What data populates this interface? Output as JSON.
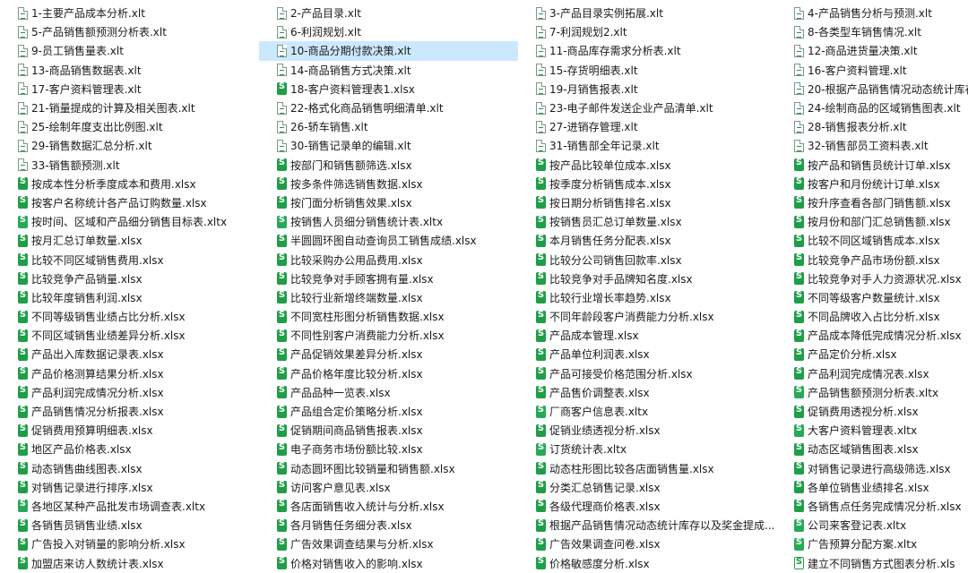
{
  "files": [
    {
      "name": "1-主要产品成本分析.xlt",
      "type": "xlt"
    },
    {
      "name": "5-产品销售额预测分析表.xlt",
      "type": "xlt"
    },
    {
      "name": "9-员工销售量表.xlt",
      "type": "xlt"
    },
    {
      "name": "13-商品销售数据表.xlt",
      "type": "xlt"
    },
    {
      "name": "17-客户资料管理表.xlt",
      "type": "xlt"
    },
    {
      "name": "21-销量提成的计算及相关图表.xlt",
      "type": "xlt"
    },
    {
      "name": "25-绘制年度支出比例图.xlt",
      "type": "xlt"
    },
    {
      "name": "29-销售数据汇总分析.xlt",
      "type": "xlt"
    },
    {
      "name": "33-销售额预测.xlt",
      "type": "xlt"
    },
    {
      "name": "按成本性分析季度成本和费用.xlsx",
      "type": "xlsx"
    },
    {
      "name": "按客户名称统计各产品订购数量.xlsx",
      "type": "xlsx"
    },
    {
      "name": "按时间、区域和产品细分销售目标表.xltx",
      "type": "xltx"
    },
    {
      "name": "按月汇总订单数量.xlsx",
      "type": "xlsx"
    },
    {
      "name": "比较不同区域销售费用.xlsx",
      "type": "xlsx"
    },
    {
      "name": "比较竞争产品销量.xlsx",
      "type": "xlsx"
    },
    {
      "name": "比较年度销售利润.xlsx",
      "type": "xlsx"
    },
    {
      "name": "不同等级销售业绩占比分析.xlsx",
      "type": "xlsx"
    },
    {
      "name": "不同区域销售业绩差异分析.xlsx",
      "type": "xlsx"
    },
    {
      "name": "产品出入库数据记录表.xlsx",
      "type": "xlsx"
    },
    {
      "name": "产品价格测算结果分析.xlsx",
      "type": "xlsx"
    },
    {
      "name": "产品利润完成情况分析.xlsx",
      "type": "xlsx"
    },
    {
      "name": "产品销售情况分析报表.xlsx",
      "type": "xlsx"
    },
    {
      "name": "促销费用预算明细表.xlsx",
      "type": "xlsx"
    },
    {
      "name": "地区产品价格表.xlsx",
      "type": "xlsx"
    },
    {
      "name": "动态销售曲线图表.xlsx",
      "type": "xlsx"
    },
    {
      "name": "对销售记录进行排序.xlsx",
      "type": "xlsx"
    },
    {
      "name": "各地区某种产品批发市场调查表.xltx",
      "type": "xltx"
    },
    {
      "name": "各销售员销售业绩.xlsx",
      "type": "xlsx"
    },
    {
      "name": "广告投入对销量的影响分析.xlsx",
      "type": "xlsx"
    },
    {
      "name": "加盟店来访人数统计表.xlsx",
      "type": "xlsx"
    },
    {
      "name": "2-产品目录.xlt",
      "type": "xlt"
    },
    {
      "name": "6-利润规划.xlt",
      "type": "xlt"
    },
    {
      "name": "10-商品分期付款决策.xlt",
      "type": "xlt",
      "selected": true
    },
    {
      "name": "14-商品销售方式决策.xlt",
      "type": "xlt"
    },
    {
      "name": "18-客户资料管理表1.xlsx",
      "type": "xlsx"
    },
    {
      "name": "22-格式化商品销售明细清单.xlt",
      "type": "xlt"
    },
    {
      "name": "26-轿车销售.xlt",
      "type": "xlt"
    },
    {
      "name": "30-销售记录单的编辑.xlt",
      "type": "xlt"
    },
    {
      "name": "按部门和销售额筛选.xlsx",
      "type": "xlsx"
    },
    {
      "name": "按多条件筛选销售数据.xlsx",
      "type": "xlsx"
    },
    {
      "name": "按门面分析销售效果.xlsx",
      "type": "xlsx"
    },
    {
      "name": "按销售人员细分销售统计表.xltx",
      "type": "xltx"
    },
    {
      "name": "半圆圆环图自动查询员工销售成绩.xlsx",
      "type": "xlsx"
    },
    {
      "name": "比较采购办公用品费用.xlsx",
      "type": "xlsx"
    },
    {
      "name": "比较竞争对手顾客拥有量.xlsx",
      "type": "xlsx"
    },
    {
      "name": "比较行业新增终端数量.xlsx",
      "type": "xlsx"
    },
    {
      "name": "不同宽柱形图分析销售数据.xlsx",
      "type": "xlsx"
    },
    {
      "name": "不同性别客户消费能力分析.xlsx",
      "type": "xlsx"
    },
    {
      "name": "产品促销效果差异分析.xlsx",
      "type": "xlsx"
    },
    {
      "name": "产品价格年度比较分析.xlsx",
      "type": "xlsx"
    },
    {
      "name": "产品品种一览表.xlsx",
      "type": "xlsx"
    },
    {
      "name": "产品组合定价策略分析.xlsx",
      "type": "xlsx"
    },
    {
      "name": "促销期间商品销售报表.xlsx",
      "type": "xlsx"
    },
    {
      "name": "电子商务市场份额比较.xlsx",
      "type": "xlsx"
    },
    {
      "name": "动态圆环图比较销量和销售额.xlsx",
      "type": "xlsx"
    },
    {
      "name": "访问客户意见表.xlsx",
      "type": "xlsx"
    },
    {
      "name": "各店面销售收入统计与分析.xlsx",
      "type": "xlsx"
    },
    {
      "name": "各月销售任务细分表.xlsx",
      "type": "xlsx"
    },
    {
      "name": "广告效果调查结果与分析.xlsx",
      "type": "xlsx"
    },
    {
      "name": "价格对销售收入的影响.xlsx",
      "type": "xlsx"
    },
    {
      "name": "3-产品目录实例拓展.xlt",
      "type": "xlt"
    },
    {
      "name": "7-利润规划2.xlt",
      "type": "xlt"
    },
    {
      "name": "11-商品库存需求分析表.xlt",
      "type": "xlt"
    },
    {
      "name": "15-存货明细表.xlt",
      "type": "xlt"
    },
    {
      "name": "19-月销售报表.xlt",
      "type": "xlt"
    },
    {
      "name": "23-电子邮件发送企业产品清单.xlt",
      "type": "xlt"
    },
    {
      "name": "27-进销存管理.xlt",
      "type": "xlt"
    },
    {
      "name": "31-销售部全年记录.xlt",
      "type": "xlt"
    },
    {
      "name": "按产品比较单位成本.xlsx",
      "type": "xlsx"
    },
    {
      "name": "按季度分析销售成本.xlsx",
      "type": "xlsx"
    },
    {
      "name": "按日期分析销售排名.xlsx",
      "type": "xlsx"
    },
    {
      "name": "按销售员汇总订单数量.xlsx",
      "type": "xlsx"
    },
    {
      "name": "本月销售任务分配表.xlsx",
      "type": "xlsx"
    },
    {
      "name": "比较分公司销售回款率.xlsx",
      "type": "xlsx"
    },
    {
      "name": "比较竞争对手品牌知名度.xlsx",
      "type": "xlsx"
    },
    {
      "name": "比较行业增长率趋势.xlsx",
      "type": "xlsx"
    },
    {
      "name": "不同年龄段客户消费能力分析.xlsx",
      "type": "xlsx"
    },
    {
      "name": "产品成本管理.xlsx",
      "type": "xlsx"
    },
    {
      "name": "产品单位利润表.xlsx",
      "type": "xlsx"
    },
    {
      "name": "产品可接受价格范围分析.xlsx",
      "type": "xlsx"
    },
    {
      "name": "产品售价调整表.xlsx",
      "type": "xlsx"
    },
    {
      "name": "厂商客户信息表.xltx",
      "type": "xltx"
    },
    {
      "name": "促销业绩透视分析.xlsx",
      "type": "xlsx"
    },
    {
      "name": "订货统计表.xltx",
      "type": "xltx"
    },
    {
      "name": "动态柱形图比较各店面销售量.xlsx",
      "type": "xlsx"
    },
    {
      "name": "分类汇总销售记录.xlsx",
      "type": "xlsx"
    },
    {
      "name": "各级代理商价格表.xlsx",
      "type": "xlsx"
    },
    {
      "name": "根据产品销售情况动态统计库存以及奖金提成...",
      "type": "xlsx"
    },
    {
      "name": "广告效果调查问卷.xlsx",
      "type": "xlsx"
    },
    {
      "name": "价格敏感度分析.xlsx",
      "type": "xlsx"
    },
    {
      "name": "4-产品销售分析与预测.xlt",
      "type": "xlt"
    },
    {
      "name": "8-各类型车销售情况.xlt",
      "type": "xlt"
    },
    {
      "name": "12-商品进货量决策.xlt",
      "type": "xlt"
    },
    {
      "name": "16-客户资料管理.xlt",
      "type": "xlt"
    },
    {
      "name": "20-根据产品销售情况动态统计库存以",
      "type": "xlt"
    },
    {
      "name": "24-绘制商品的区域销售图表.xlt",
      "type": "xlt"
    },
    {
      "name": "28-销售报表分析.xlt",
      "type": "xlt"
    },
    {
      "name": "32-销售部员工资料表.xlt",
      "type": "xlt"
    },
    {
      "name": "按产品和销售员统计订单.xlsx",
      "type": "xlsx"
    },
    {
      "name": "按客户和月份统计订单.xlsx",
      "type": "xlsx"
    },
    {
      "name": "按升序查看各部门销售额.xlsx",
      "type": "xlsx"
    },
    {
      "name": "按月份和部门汇总销售额.xlsx",
      "type": "xlsx"
    },
    {
      "name": "比较不同区域销售成本.xlsx",
      "type": "xlsx"
    },
    {
      "name": "比较竞争产品市场份额.xlsx",
      "type": "xlsx"
    },
    {
      "name": "比较竞争对手人力资源状况.xlsx",
      "type": "xlsx"
    },
    {
      "name": "不同等级客户数量统计.xlsx",
      "type": "xlsx"
    },
    {
      "name": "不同品牌收入占比分析.xlsx",
      "type": "xlsx"
    },
    {
      "name": "产品成本降低完成情况分析.xlsx",
      "type": "xlsx"
    },
    {
      "name": "产品定价分析.xlsx",
      "type": "xlsx"
    },
    {
      "name": "产品利润完成情况表.xlsx",
      "type": "xlsx"
    },
    {
      "name": "产品销售额预测分析表.xltx",
      "type": "xltx"
    },
    {
      "name": "促销费用透视分析.xlsx",
      "type": "xlsx"
    },
    {
      "name": "大客户资料管理表.xltx",
      "type": "xltx"
    },
    {
      "name": "动态区域销售图表.xlsx",
      "type": "xlsx"
    },
    {
      "name": "对销售记录进行高级筛选.xlsx",
      "type": "xlsx"
    },
    {
      "name": "各单位销售业绩排名.xlsx",
      "type": "xlsx"
    },
    {
      "name": "各销售点任务完成情况分析.xlsx",
      "type": "xlsx"
    },
    {
      "name": "公司来客登记表.xltx",
      "type": "xltx"
    },
    {
      "name": "广告预算分配方案.xltx",
      "type": "xltx"
    },
    {
      "name": "建立不同销售方式图表分析.xls",
      "type": "xls"
    }
  ]
}
